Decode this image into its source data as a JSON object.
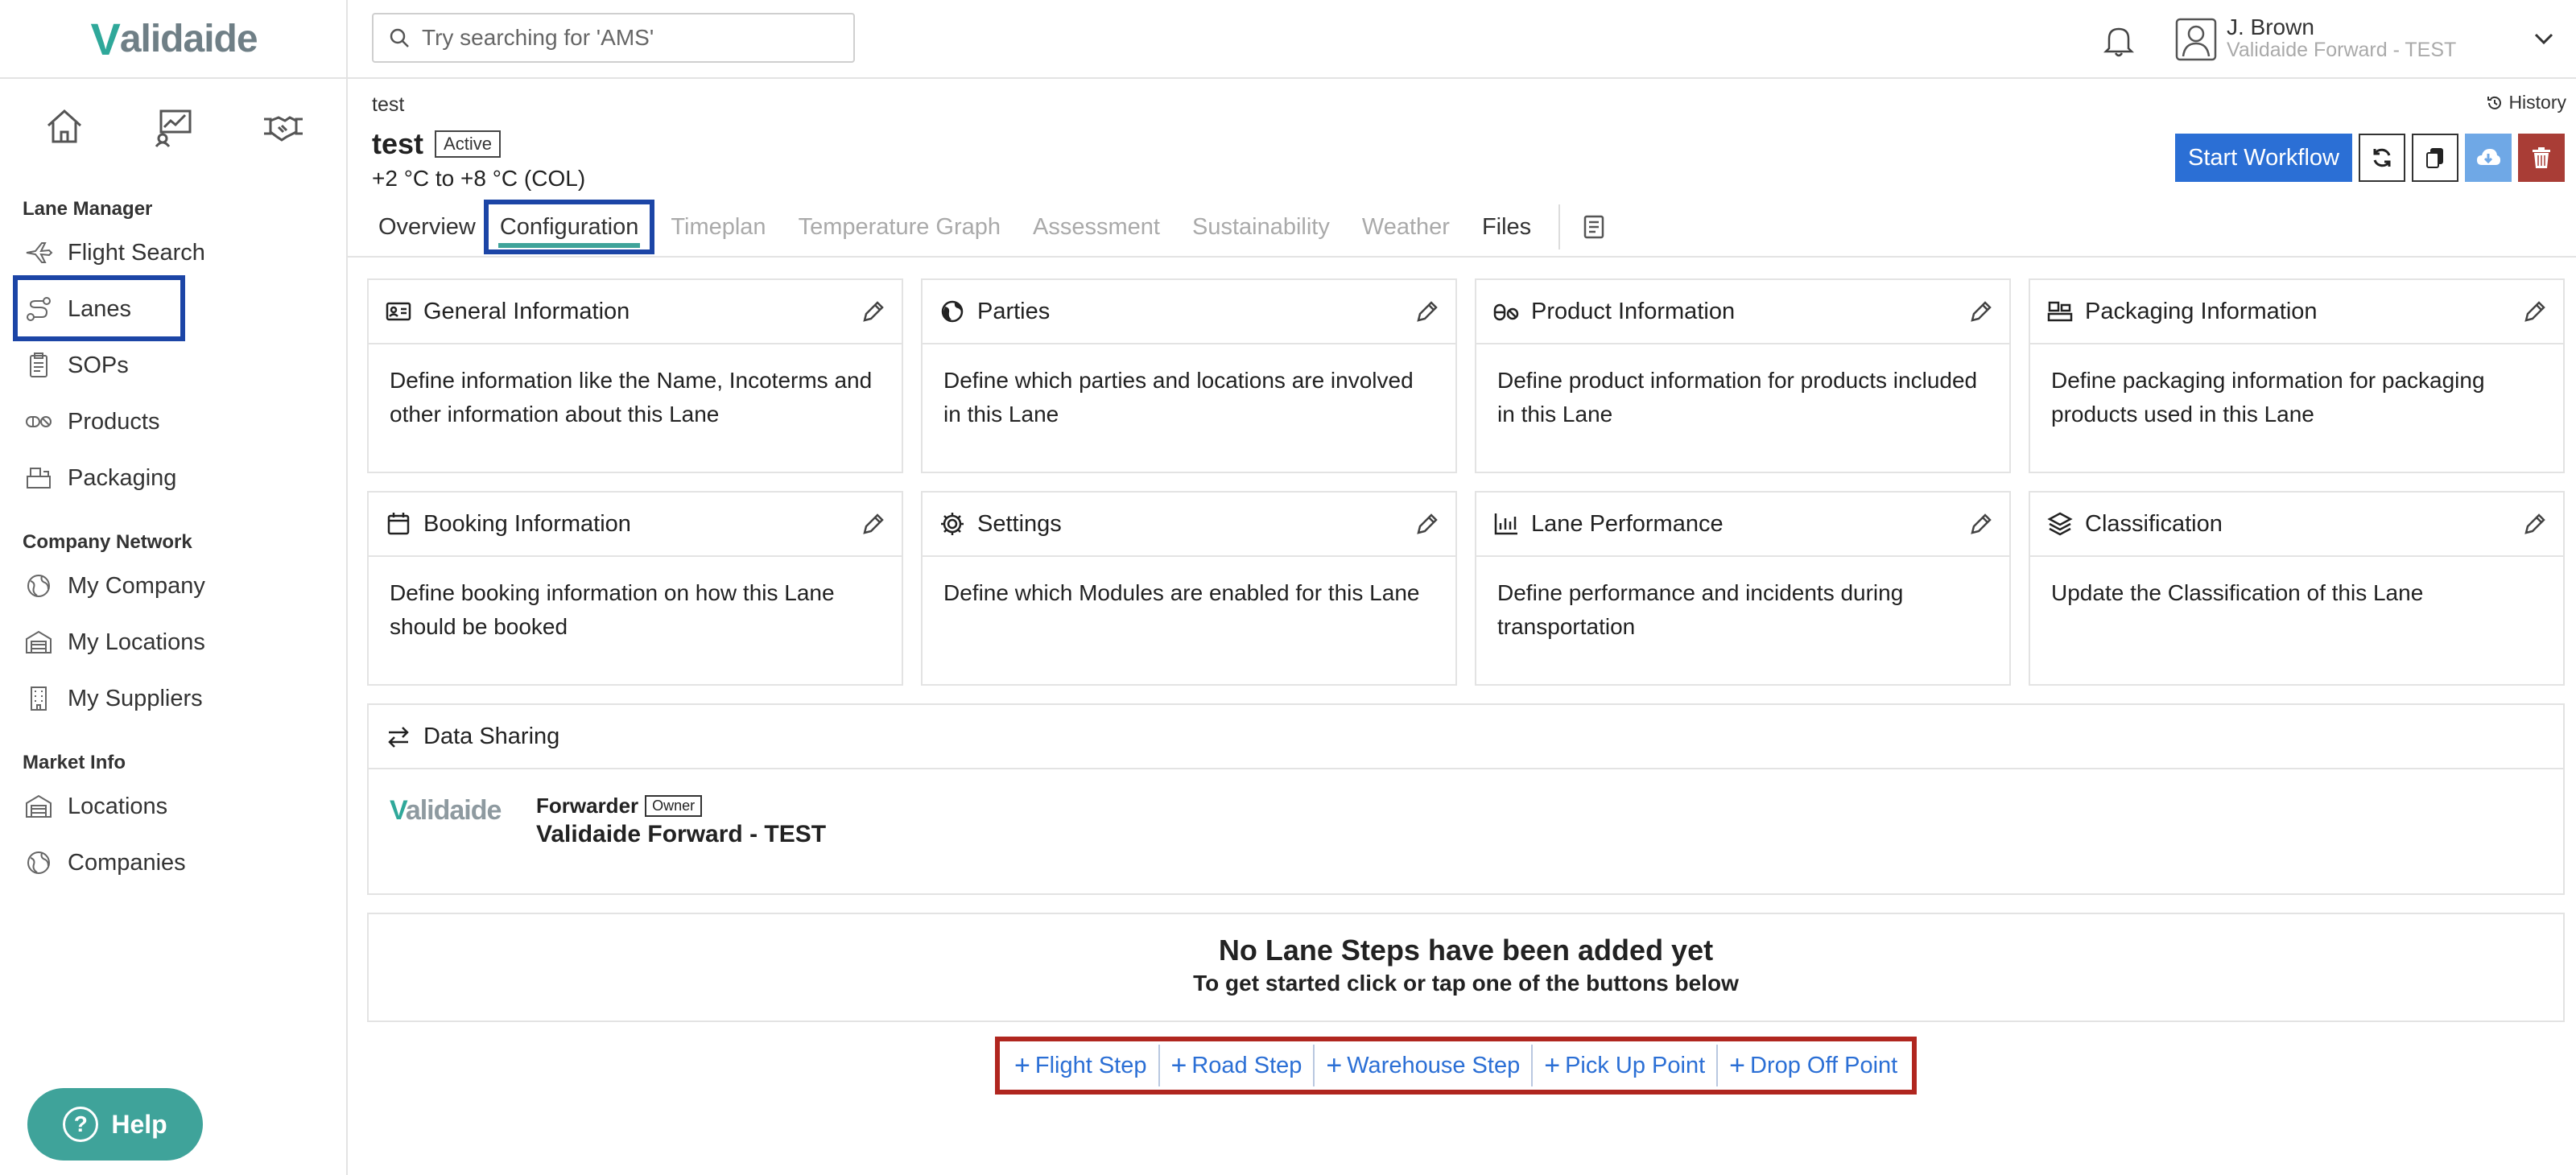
{
  "brand": {
    "logo_v": "V",
    "logo_rest": "alidaide"
  },
  "topbar": {
    "search_placeholder": "Try searching for 'AMS'",
    "user_name": "J. Brown",
    "user_org": "Validaide Forward - TEST"
  },
  "sidebar": {
    "sections": [
      {
        "title": "Lane Manager",
        "items": [
          "Flight Search",
          "Lanes",
          "SOPs",
          "Products",
          "Packaging"
        ]
      },
      {
        "title": "Company Network",
        "items": [
          "My Company",
          "My Locations",
          "My Suppliers"
        ]
      },
      {
        "title": "Market Info",
        "items": [
          "Locations",
          "Companies"
        ]
      }
    ],
    "help_label": "Help"
  },
  "lane": {
    "breadcrumb": "test",
    "title": "test",
    "status": "Active",
    "temperature": "+2 °C to +8 °C (COL)",
    "history_label": "History",
    "start_workflow_label": "Start Workflow"
  },
  "tabs": [
    "Overview",
    "Configuration",
    "Timeplan",
    "Temperature Graph",
    "Assessment",
    "Sustainability",
    "Weather",
    "Files"
  ],
  "active_tab": "Configuration",
  "cards": [
    {
      "title": "General Information",
      "body": "Define information like the Name, Incoterms and other information about this Lane",
      "icon": "id-card-icon"
    },
    {
      "title": "Parties",
      "body": "Define which parties and locations are involved in this Lane",
      "icon": "globe-icon"
    },
    {
      "title": "Product Information",
      "body": "Define product information for products included in this Lane",
      "icon": "pills-icon"
    },
    {
      "title": "Packaging Information",
      "body": "Define packaging information for packaging products used in this Lane",
      "icon": "packaging-icon"
    },
    {
      "title": "Booking Information",
      "body": "Define booking information on how this Lane should be booked",
      "icon": "calendar-icon"
    },
    {
      "title": "Settings",
      "body": "Define which Modules are enabled for this Lane",
      "icon": "gear-icon"
    },
    {
      "title": "Lane Performance",
      "body": "Define performance and incidents during transportation",
      "icon": "bar-chart-icon"
    },
    {
      "title": "Classification",
      "body": "Update the Classification of this Lane",
      "icon": "layers-icon"
    }
  ],
  "data_sharing": {
    "title": "Data Sharing",
    "role": "Forwarder",
    "owner_badge": "Owner",
    "company": "Validaide Forward - TEST",
    "logo_v": "V",
    "logo_rest": "alidaide"
  },
  "lane_steps": {
    "empty_title": "No Lane Steps have been added yet",
    "empty_subtitle": "To get started click or tap one of the buttons below",
    "buttons": [
      "Flight Step",
      "Road Step",
      "Warehouse Step",
      "Pick Up Point",
      "Drop Off Point"
    ]
  },
  "colors": {
    "primary": "#2b6fd5",
    "teal": "#3fa39a",
    "danger": "#a93d36",
    "highlight_blue": "#1c45a6",
    "highlight_red": "#b0261f"
  }
}
